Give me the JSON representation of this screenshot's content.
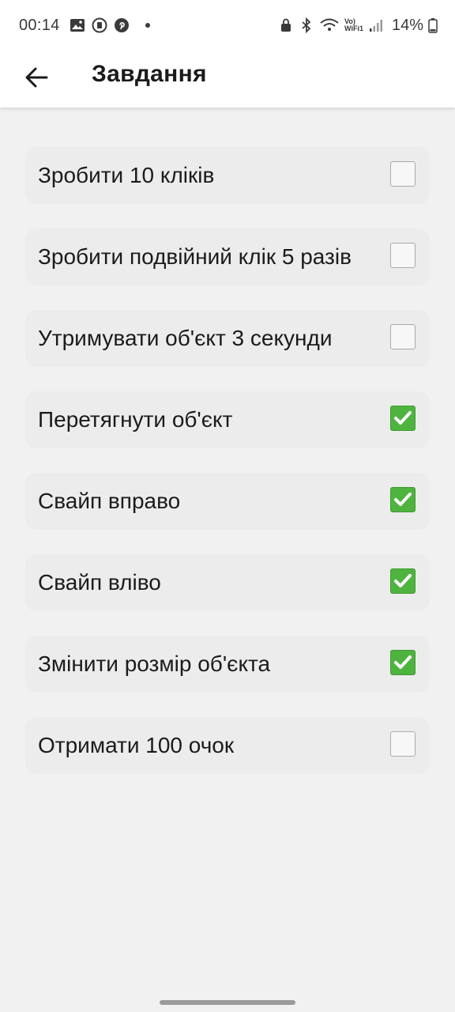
{
  "status_bar": {
    "time": "00:14",
    "battery_percent": "14%",
    "wifi_label_top": "Vo)",
    "wifi_label_bottom": "WiFi1",
    "icons": [
      "image-icon",
      "vpn-icon",
      "pinterest-icon",
      "dot-icon",
      "lock-icon",
      "bluetooth-icon",
      "wifi-icon",
      "signal-icon",
      "battery-icon"
    ]
  },
  "app_bar": {
    "title": "Завдання",
    "back_icon": "arrow-left-icon"
  },
  "colors": {
    "background": "#f1f1f1",
    "row_background": "#ececec",
    "checked": "#4fb43f"
  },
  "tasks": [
    {
      "label": "Зробити 10 кліків",
      "done": false
    },
    {
      "label": "Зробити подвійний клік 5 разів",
      "done": false
    },
    {
      "label": "Утримувати об'єкт 3 секунди",
      "done": false
    },
    {
      "label": "Перетягнути об'єкт",
      "done": true
    },
    {
      "label": "Свайп вправо",
      "done": true
    },
    {
      "label": "Свайп вліво",
      "done": true
    },
    {
      "label": "Змінити розмір об'єкта",
      "done": true
    },
    {
      "label": "Отримати 100 очок",
      "done": false
    }
  ]
}
